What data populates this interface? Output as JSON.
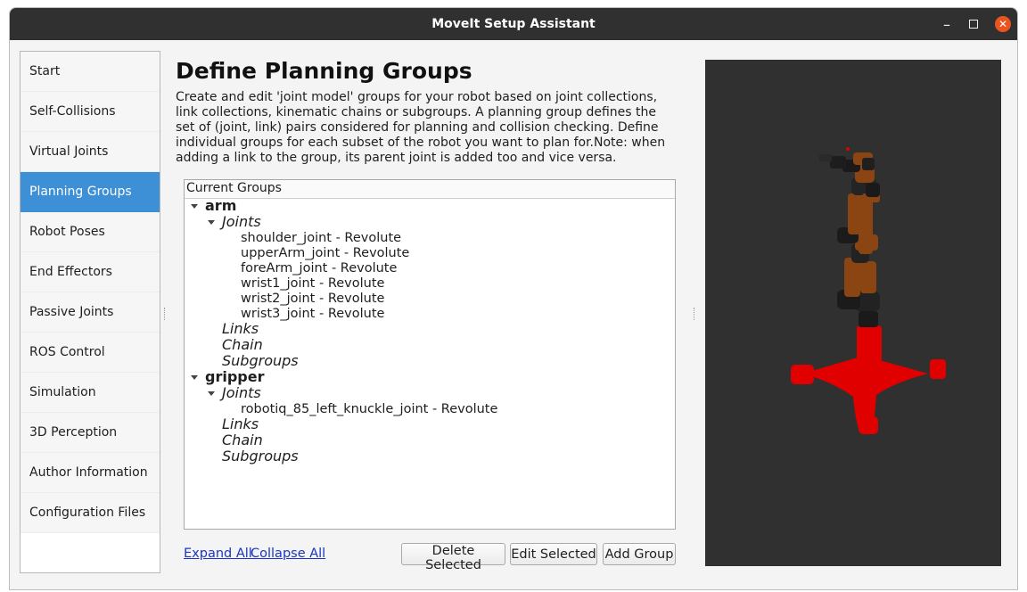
{
  "window": {
    "title": "MoveIt Setup Assistant"
  },
  "sidebar": {
    "items": [
      {
        "label": "Start"
      },
      {
        "label": "Self-Collisions"
      },
      {
        "label": "Virtual Joints"
      },
      {
        "label": "Planning Groups"
      },
      {
        "label": "Robot Poses"
      },
      {
        "label": "End Effectors"
      },
      {
        "label": "Passive Joints"
      },
      {
        "label": "ROS Control"
      },
      {
        "label": "Simulation"
      },
      {
        "label": "3D Perception"
      },
      {
        "label": "Author Information"
      },
      {
        "label": "Configuration Files"
      }
    ],
    "active": "Planning Groups"
  },
  "page": {
    "title": "Define Planning Groups",
    "description": "Create and edit 'joint model' groups for your robot based on joint collections, link collections, kinematic chains or subgroups. A planning group defines the set of (joint, link) pairs considered for planning and collision checking. Define individual groups for each subset of the robot you want to plan for.Note: when adding a link to the group, its parent joint is added too and vice versa."
  },
  "tree": {
    "header": "Current Groups",
    "groups": [
      {
        "name": "arm",
        "joints_label": "Joints",
        "joints": [
          "shoulder_joint - Revolute",
          "upperArm_joint - Revolute",
          "foreArm_joint - Revolute",
          "wrist1_joint - Revolute",
          "wrist2_joint - Revolute",
          "wrist3_joint - Revolute"
        ],
        "links_label": "Links",
        "chain_label": "Chain",
        "subgroups_label": "Subgroups"
      },
      {
        "name": "gripper",
        "joints_label": "Joints",
        "joints": [
          "robotiq_85_left_knuckle_joint - Revolute"
        ],
        "links_label": "Links",
        "chain_label": "Chain",
        "subgroups_label": "Subgroups"
      }
    ]
  },
  "actions": {
    "expand_all": "Expand All",
    "collapse_all": "Collapse All",
    "delete_selected": "Delete Selected",
    "edit_selected": "Edit Selected",
    "add_group": "Add Group"
  },
  "colors": {
    "accent": "#3d8fd6",
    "titlebar": "#303030",
    "close_button": "#e9541f",
    "viewport_bg": "#303030",
    "robot_base": "#e00000",
    "robot_arm": "#8b4513"
  }
}
